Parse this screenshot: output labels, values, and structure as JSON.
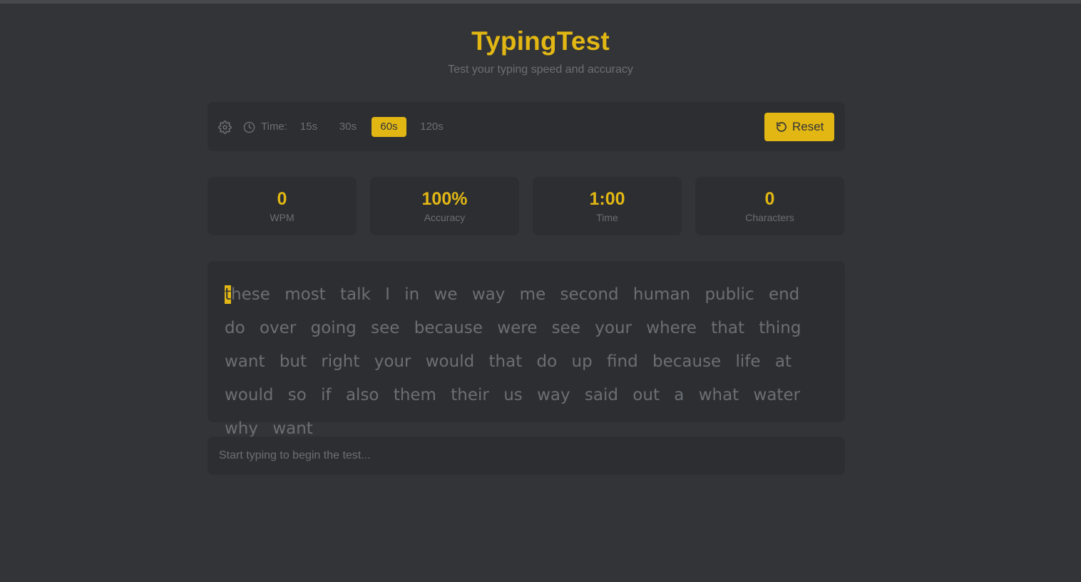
{
  "app": {
    "title": "TypingTest",
    "subtitle": "Test your typing speed and accuracy"
  },
  "toolbar": {
    "settings_icon": "gear-icon",
    "clock_icon": "clock-icon",
    "time_label": "Time:",
    "time_options": [
      {
        "label": "15s",
        "active": false
      },
      {
        "label": "30s",
        "active": false
      },
      {
        "label": "60s",
        "active": true
      },
      {
        "label": "120s",
        "active": false
      }
    ],
    "reset_icon": "rotate-ccw-icon",
    "reset_label": "Reset"
  },
  "stats": [
    {
      "value": "0",
      "label": "WPM"
    },
    {
      "value": "100%",
      "label": "Accuracy"
    },
    {
      "value": "1:00",
      "label": "Time"
    },
    {
      "value": "0",
      "label": "Characters"
    }
  ],
  "words": {
    "current_char": "t",
    "current_rest": "hese",
    "list": [
      "these",
      "most",
      "talk",
      "I",
      "in",
      "we",
      "way",
      "me",
      "second",
      "human",
      "public",
      "end",
      "do",
      "over",
      "going",
      "see",
      "because",
      "were",
      "see",
      "your",
      "where",
      "that",
      "thing",
      "want",
      "but",
      "right",
      "your",
      "would",
      "that",
      "do",
      "up",
      "find",
      "because",
      "life",
      "at",
      "would",
      "so",
      "if",
      "also",
      "them",
      "their",
      "us",
      "way",
      "said",
      "out",
      "a",
      "what",
      "water",
      "why",
      "want"
    ]
  },
  "input": {
    "placeholder": "Start typing to begin the test...",
    "value": ""
  },
  "colors": {
    "background": "#323437",
    "panel": "#2c2e31",
    "accent": "#e2b714",
    "muted": "#6b6f74"
  }
}
